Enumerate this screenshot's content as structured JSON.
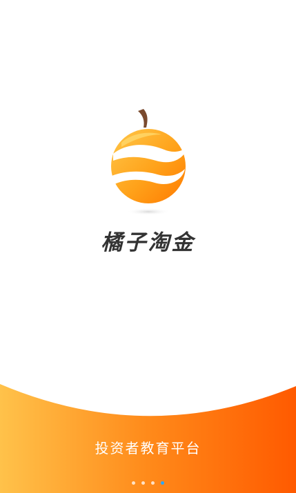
{
  "app": {
    "brand_name": "橘子淘金",
    "tagline": "投资者教育平台"
  },
  "logo": {
    "icon": "orange-fruit-logo-icon"
  },
  "pager": {
    "page_count": 4,
    "current_page": 4
  },
  "colors": {
    "brand_orange": "#ff8a00",
    "orange_light": "#ffc53d",
    "orange_dark": "#ff5a00",
    "stem_brown": "#7a4a2e",
    "text_dark": "#333333",
    "pager_active": "#2aa7ff"
  }
}
